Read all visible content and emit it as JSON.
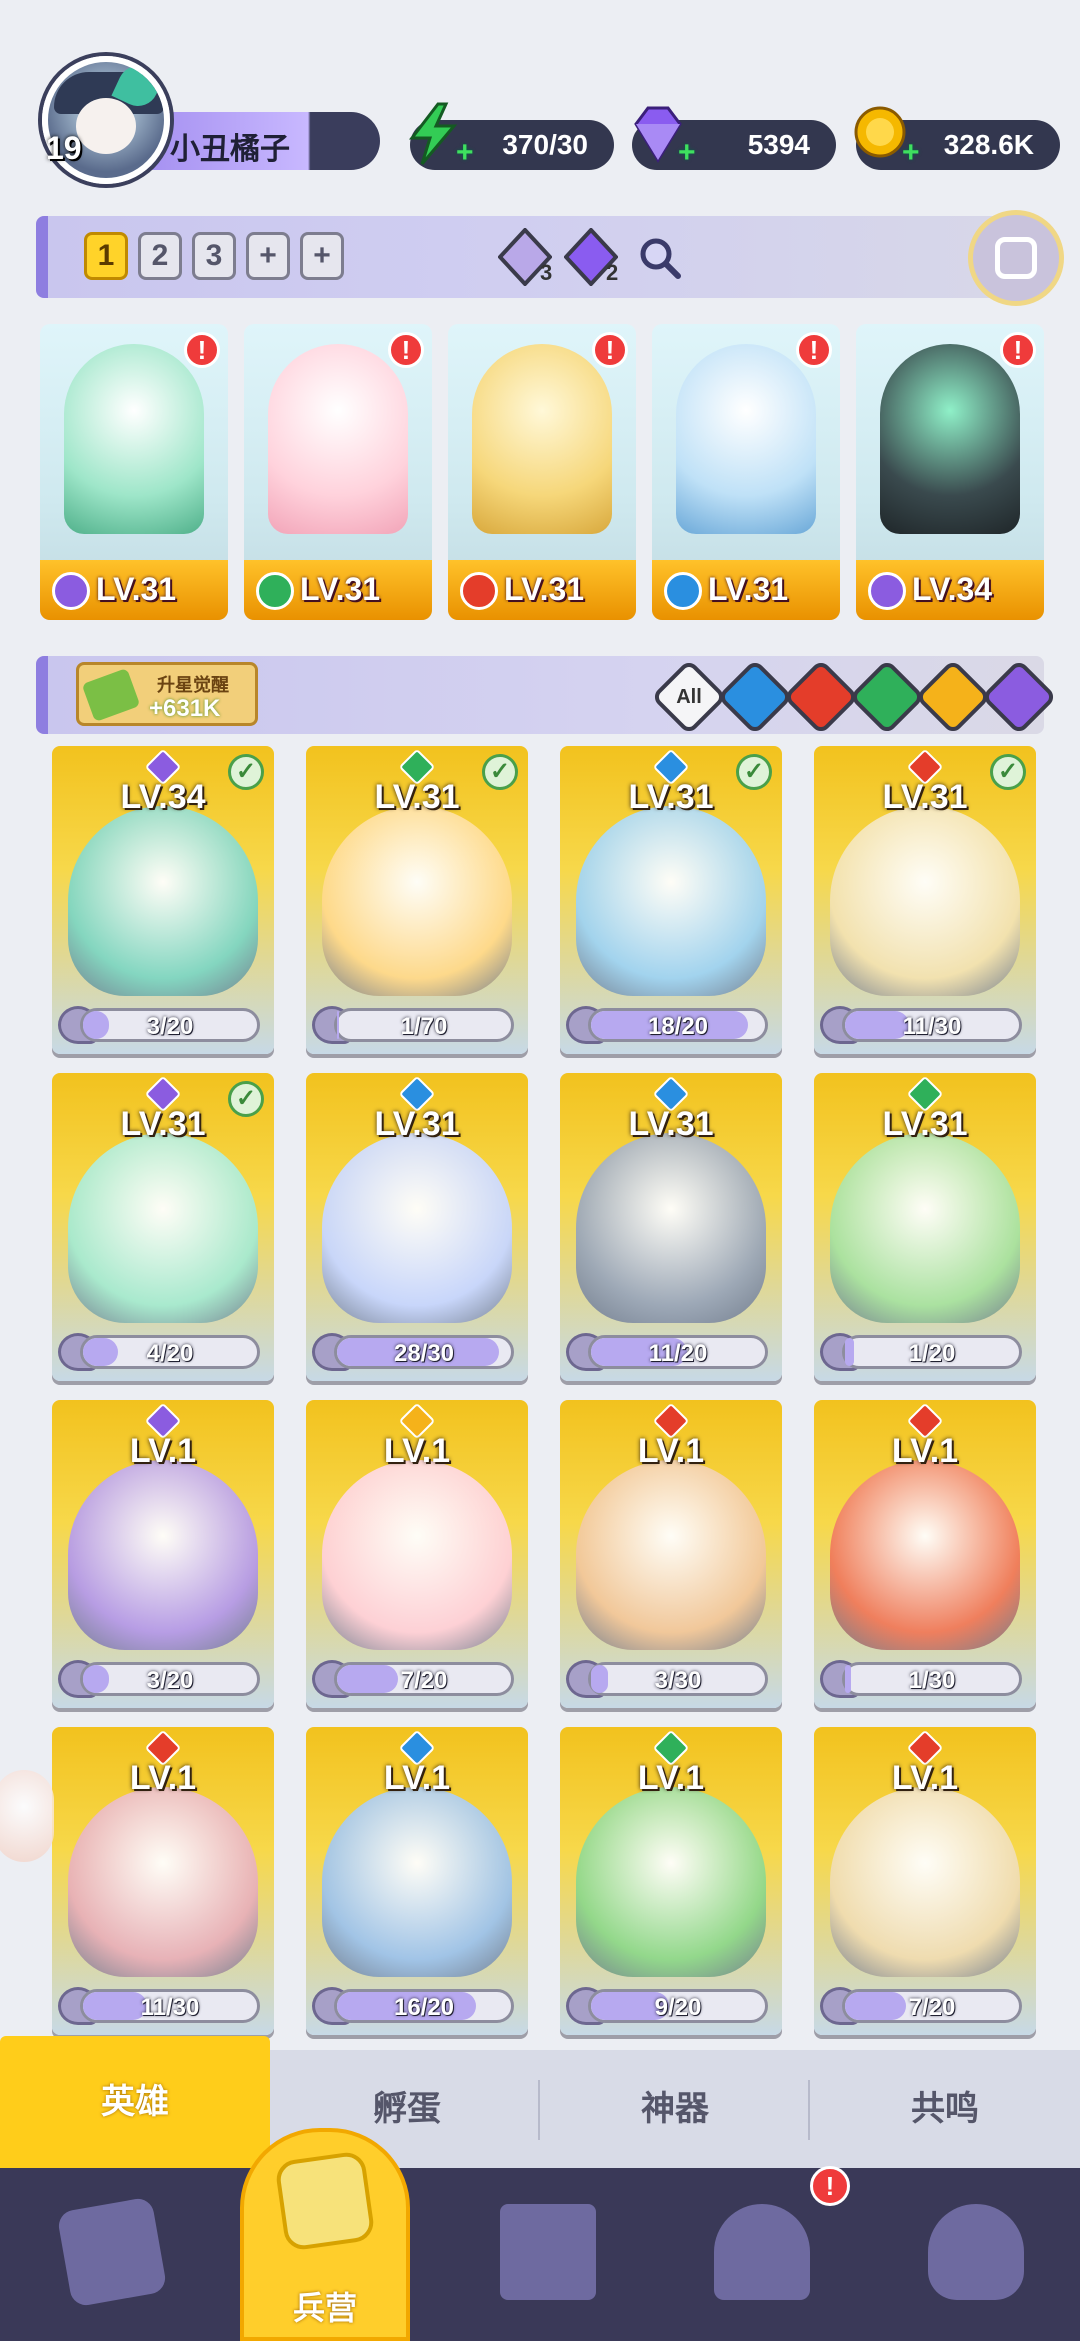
{
  "player": {
    "level": "19",
    "name": "小丑橘子"
  },
  "resources": [
    {
      "name": "energy",
      "icon": "lightning-icon",
      "value": "370/30",
      "color": "#33cc55"
    },
    {
      "name": "gems",
      "icon": "diamond-icon",
      "value": "5394",
      "color": "#8a5cf0"
    },
    {
      "name": "coins",
      "icon": "coin-icon",
      "value": "328.6K",
      "color": "#f5b800"
    }
  ],
  "team_bar": {
    "team_tabs": [
      "1",
      "2",
      "3",
      "+",
      "+"
    ],
    "active_team": "1",
    "gem_a_count": "3",
    "gem_b_count": "2"
  },
  "team": [
    {
      "level": "LV.31",
      "element": "dark",
      "color": "#8b5ce0"
    },
    {
      "level": "LV.31",
      "element": "nature",
      "color": "#2fb05a"
    },
    {
      "level": "LV.31",
      "element": "fire",
      "color": "#e43d2a"
    },
    {
      "level": "LV.31",
      "element": "water",
      "color": "#2a8fe0"
    },
    {
      "level": "LV.34",
      "element": "dark",
      "color": "#8b5ce0"
    }
  ],
  "filter_bar": {
    "awaken_title": "升星觉醒",
    "awaken_value": "+631K",
    "all_label": "All",
    "elements": [
      "water",
      "fire",
      "nature",
      "light",
      "dark"
    ]
  },
  "element_colors": {
    "water": "#2a8fe0",
    "fire": "#e43d2a",
    "nature": "#2fb05a",
    "light": "#f5b21a",
    "dark": "#8b5ce0"
  },
  "heroes": [
    {
      "level": "LV.34",
      "element": "dark",
      "progress": "3/20",
      "checked": true
    },
    {
      "level": "LV.31",
      "element": "nature",
      "progress": "1/70",
      "checked": true
    },
    {
      "level": "LV.31",
      "element": "water",
      "progress": "18/20",
      "checked": true
    },
    {
      "level": "LV.31",
      "element": "fire",
      "progress": "11/30",
      "checked": true
    },
    {
      "level": "LV.31",
      "element": "dark",
      "progress": "4/20",
      "checked": true
    },
    {
      "level": "LV.31",
      "element": "water",
      "progress": "28/30",
      "checked": false
    },
    {
      "level": "LV.31",
      "element": "water",
      "progress": "11/20",
      "checked": false
    },
    {
      "level": "LV.31",
      "element": "nature",
      "progress": "1/20",
      "checked": false
    },
    {
      "level": "LV.1",
      "element": "dark",
      "progress": "3/20",
      "checked": false
    },
    {
      "level": "LV.1",
      "element": "light",
      "progress": "7/20",
      "checked": false
    },
    {
      "level": "LV.1",
      "element": "fire",
      "progress": "3/30",
      "checked": false
    },
    {
      "level": "LV.1",
      "element": "fire",
      "progress": "1/30",
      "checked": false
    },
    {
      "level": "LV.1",
      "element": "fire",
      "progress": "11/30",
      "checked": false
    },
    {
      "level": "LV.1",
      "element": "water",
      "progress": "16/20",
      "checked": false
    },
    {
      "level": "LV.1",
      "element": "nature",
      "progress": "9/20",
      "checked": false
    },
    {
      "level": "LV.1",
      "element": "fire",
      "progress": "7/20",
      "checked": false
    }
  ],
  "sub_tabs": [
    {
      "label": "英雄",
      "active": true
    },
    {
      "label": "孵蛋",
      "active": false
    },
    {
      "label": "神器",
      "active": false
    },
    {
      "label": "共鸣",
      "active": false
    }
  ],
  "bottom_nav": {
    "items": [
      "cards-icon",
      "map-icon",
      "barracks-icon",
      "shrine-icon",
      "mushroom-icon"
    ],
    "active_label": "兵营"
  }
}
